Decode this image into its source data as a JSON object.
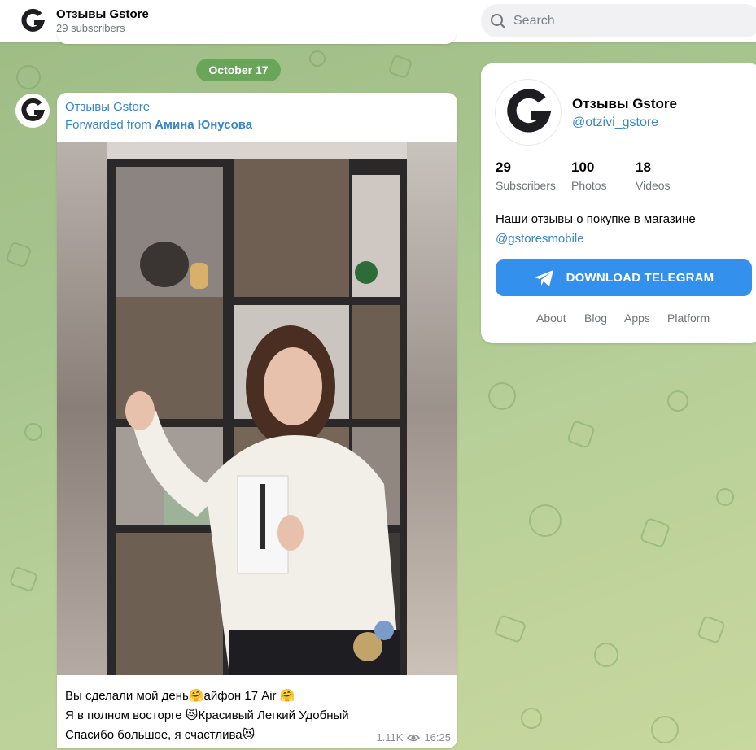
{
  "header": {
    "channel_name": "Отзывы Gstore",
    "subscribers": "29 subscribers",
    "avatar_icon": "gstore-logo-icon"
  },
  "search": {
    "placeholder": "Search",
    "icon": "search-icon"
  },
  "feed": {
    "date_label": "October 17",
    "message": {
      "author": "Отзывы Gstore",
      "forwarded_prefix": "Forwarded from",
      "forwarded_name": "Амина Юнусова",
      "text_lines": [
        "Вы сделали мой день🤗айфон 17 Air 🤗",
        "Я в полном восторге 😻Красивый Легкий Удобный",
        "Спасибо большое, я счастлива😻"
      ],
      "views": "1.11K",
      "time": "16:25"
    }
  },
  "channel_card": {
    "title": "Отзывы Gstore",
    "username": "@otzivi_gstore",
    "stats": [
      {
        "value": "29",
        "label": "Subscribers"
      },
      {
        "value": "100",
        "label": "Photos"
      },
      {
        "value": "18",
        "label": "Videos"
      }
    ],
    "description": "Наши отзывы о покупке в магазине",
    "description_mention": "@gstoresmobile",
    "download_button": "DOWNLOAD TELEGRAM",
    "links": [
      "About",
      "Blog",
      "Apps",
      "Platform"
    ]
  },
  "colors": {
    "accent": "#3390ec",
    "link": "#3a86c4",
    "date_pill": "#6aa65a"
  }
}
